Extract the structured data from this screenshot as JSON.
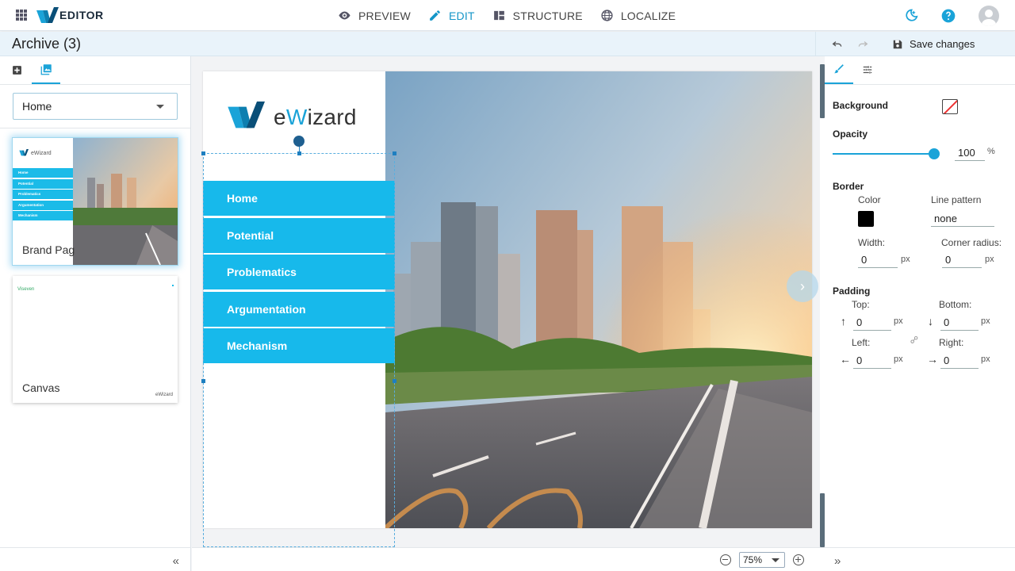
{
  "app": {
    "logo_text": "EDITOR",
    "modes": [
      {
        "label": "PREVIEW",
        "icon": "eye-icon",
        "active": false
      },
      {
        "label": "EDIT",
        "icon": "pencil-icon",
        "active": true
      },
      {
        "label": "STRUCTURE",
        "icon": "structure-icon",
        "active": false
      },
      {
        "label": "LOCALIZE",
        "icon": "globe-icon",
        "active": false
      }
    ],
    "accent_color": "#1aa3d8"
  },
  "subheader": {
    "title": "Archive (3)",
    "save_label": "Save changes"
  },
  "left": {
    "page_select": "Home",
    "thumbnails": [
      {
        "label": "Brand Pag",
        "selected": true
      },
      {
        "label": "Canvas",
        "selected": false
      }
    ],
    "thumb_menu": [
      "Home",
      "Potential",
      "Problematics",
      "Argumentation",
      "Mechanism"
    ],
    "thumb1_logo": "eWizard",
    "thumb2_logo": "Viseven",
    "thumb2_logo_br": "eWizard"
  },
  "slide": {
    "logo_e": "e",
    "logo_w": "W",
    "logo_rest": "izard",
    "menu": [
      "Home",
      "Potential",
      "Problematics",
      "Argumentation",
      "Mechanism"
    ],
    "menu_color": "#17b9eb"
  },
  "zoom": {
    "value": "75%"
  },
  "properties": {
    "background_label": "Background",
    "opacity_label": "Opacity",
    "opacity_value": "100",
    "opacity_unit": "%",
    "opacity_level": 1.0,
    "border_label": "Border",
    "color_label": "Color",
    "border_color": "#000000",
    "line_pattern_label": "Line pattern",
    "line_pattern_value": "none",
    "width_label": "Width:",
    "width_value": "0",
    "corner_label": "Corner radius:",
    "corner_value": "0",
    "px": "px",
    "padding_label": "Padding",
    "top_label": "Top:",
    "top_value": "0",
    "bottom_label": "Bottom:",
    "bottom_value": "0",
    "left_label": "Left:",
    "left_value": "0",
    "right_label": "Right:",
    "right_value": "0"
  }
}
